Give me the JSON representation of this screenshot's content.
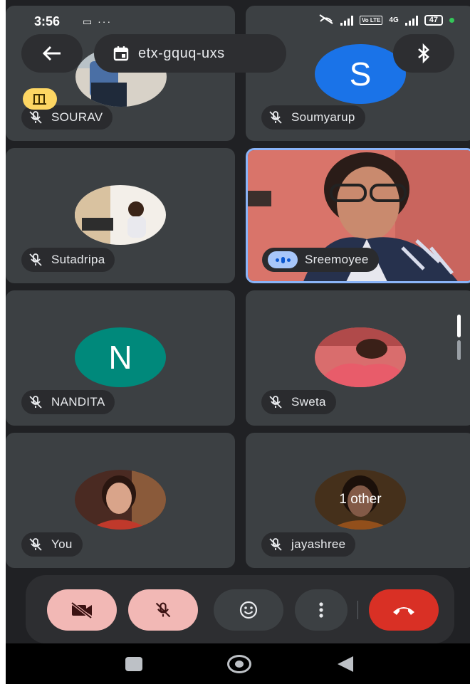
{
  "status_bar": {
    "time": "3:56",
    "left_icons": "▭ ···",
    "network": "4G",
    "lte": "Vo LTE",
    "battery": "47"
  },
  "top_bar": {
    "back_icon": "arrow-left-icon",
    "meeting_code": "etx-gquq-uxs",
    "calendar_icon": "calendar-icon",
    "bluetooth_icon": "bluetooth-icon"
  },
  "participants": [
    {
      "name": "SOURAV",
      "mic": "muted",
      "avatar": "photo",
      "raised_hand": true
    },
    {
      "name": "Soumyarup",
      "mic": "muted",
      "avatar": "letter",
      "letter": "S",
      "color": "#1a73e8"
    },
    {
      "name": "Sutadripa",
      "mic": "muted",
      "avatar": "photo"
    },
    {
      "name": "Sreemoyee",
      "mic": "speaking",
      "avatar": "video"
    },
    {
      "name": "NANDITA",
      "mic": "muted",
      "avatar": "letter",
      "letter": "N",
      "color": "#00897b"
    },
    {
      "name": "Sweta",
      "mic": "muted",
      "avatar": "photo"
    },
    {
      "name": "You",
      "mic": "muted",
      "avatar": "photo"
    },
    {
      "name": "jayashree",
      "mic": "muted",
      "avatar": "photo",
      "overlay": "1 other"
    }
  ],
  "controls": {
    "camera": "camera-off-icon",
    "mic": "mic-off-icon",
    "reactions": "emoji-icon",
    "more": "more-vert-icon",
    "end_call": "call-end-icon"
  },
  "colors": {
    "background": "#202124",
    "tile": "#3c4043",
    "muted_button": "#f2b8b5",
    "end_call": "#d93025",
    "speaking_border": "#8ab4f8"
  }
}
